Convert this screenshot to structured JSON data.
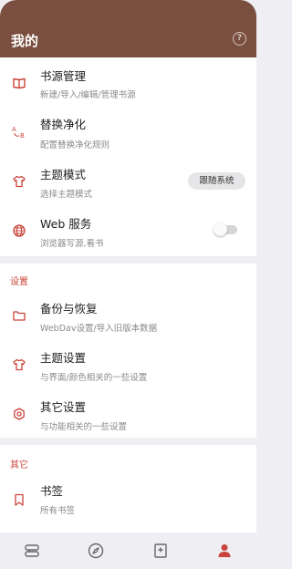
{
  "header": {
    "title": "我的",
    "help_glyph": "?"
  },
  "accent_color": "#c9443a",
  "header_color": "#7a4f3f",
  "items": [
    {
      "title": "书源管理",
      "subtitle": "新建/导入/编辑/管理书源",
      "icon": "book-open-icon"
    },
    {
      "title": "替换净化",
      "subtitle": "配置替换净化规则",
      "icon": "replace-icon"
    },
    {
      "title": "主题模式",
      "subtitle": "选择主题模式",
      "icon": "shirt-icon",
      "value": "跟随系统"
    },
    {
      "title": "Web 服务",
      "subtitle": "浏览器写源,看书",
      "icon": "globe-icon",
      "toggle_on": false
    }
  ],
  "settings_section": {
    "label": "设置",
    "items": [
      {
        "title": "备份与恢复",
        "subtitle": "WebDav设置/导入旧版本数据",
        "icon": "folder-icon"
      },
      {
        "title": "主题设置",
        "subtitle": "与界面/颜色相关的一些设置",
        "icon": "shirt-icon"
      },
      {
        "title": "其它设置",
        "subtitle": "与功能相关的一些设置",
        "icon": "settings-icon"
      }
    ]
  },
  "other_section": {
    "label": "其它",
    "items": [
      {
        "title": "书签",
        "subtitle": "所有书签",
        "icon": "bookmark-icon"
      }
    ]
  },
  "bottom_nav": [
    {
      "icon": "bookshelf-icon",
      "active": false
    },
    {
      "icon": "compass-icon",
      "active": false
    },
    {
      "icon": "rss-bookmark-icon",
      "active": false
    },
    {
      "icon": "person-icon",
      "active": true
    }
  ]
}
